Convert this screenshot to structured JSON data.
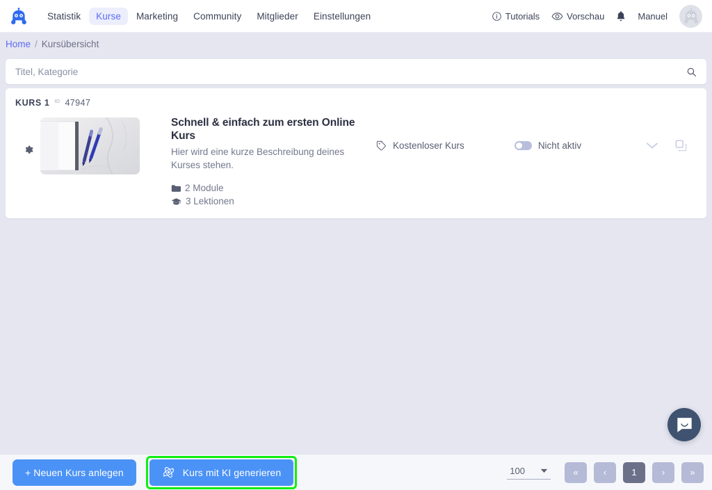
{
  "header": {
    "logo_icon": "robot-logo-icon",
    "nav": [
      {
        "label": "Statistik",
        "active": false
      },
      {
        "label": "Kurse",
        "active": true
      },
      {
        "label": "Marketing",
        "active": false
      },
      {
        "label": "Community",
        "active": false
      },
      {
        "label": "Mitglieder",
        "active": false
      },
      {
        "label": "Einstellungen",
        "active": false
      }
    ],
    "tutorials_label": "Tutorials",
    "tutorials_icon": "info-circle-icon",
    "preview_label": "Vorschau",
    "preview_icon": "eye-icon",
    "notification_icon": "bell-icon",
    "user_name": "Manuel",
    "avatar_icon": "robot-avatar-icon"
  },
  "breadcrumb": {
    "home": "Home",
    "separator": "/",
    "current": "Kursübersicht"
  },
  "search": {
    "placeholder": "Titel, Kategorie",
    "value": "",
    "icon": "search-icon"
  },
  "course": {
    "kurs_label": "KURS 1",
    "id_label": "ID",
    "id_value": "47947",
    "settings_icon": "gear-icon",
    "thumbnail_alt": "notebook-and-pens-photo",
    "title": "Schnell & einfach zum ersten Online Kurs",
    "description": "Hier wird eine kurze Beschreibung deines Kurses stehen.",
    "modules_icon": "folder-icon",
    "modules_text": "2 Module",
    "lessons_icon": "graduation-cap-icon",
    "lessons_text": "3 Lektionen",
    "price_icon": "tag-icon",
    "price_label": "Kostenloser Kurs",
    "status_label": "Nicht aktiv",
    "status_active": false,
    "expand_icon": "chevron-down-icon",
    "duplicate_icon": "duplicate-icon"
  },
  "chat": {
    "icon": "chat-bubble-icon"
  },
  "footer": {
    "new_course_label": "+ Neuen Kurs anlegen",
    "ai_course_label": "Kurs mit KI generieren",
    "ai_icon": "ai-sparkle-icon",
    "highlight_color": "#11ef11",
    "per_page_value": "100",
    "per_page_caret": "caret-down-icon",
    "pagination": {
      "first_label": "«",
      "prev_label": "‹",
      "current_page": "1",
      "next_label": "›",
      "last_label": "»"
    }
  },
  "colors": {
    "accent": "#5b6bf5",
    "button_blue": "#4b92f6",
    "page_bg": "#e6e6f0",
    "highlight_green": "#11ef11"
  }
}
